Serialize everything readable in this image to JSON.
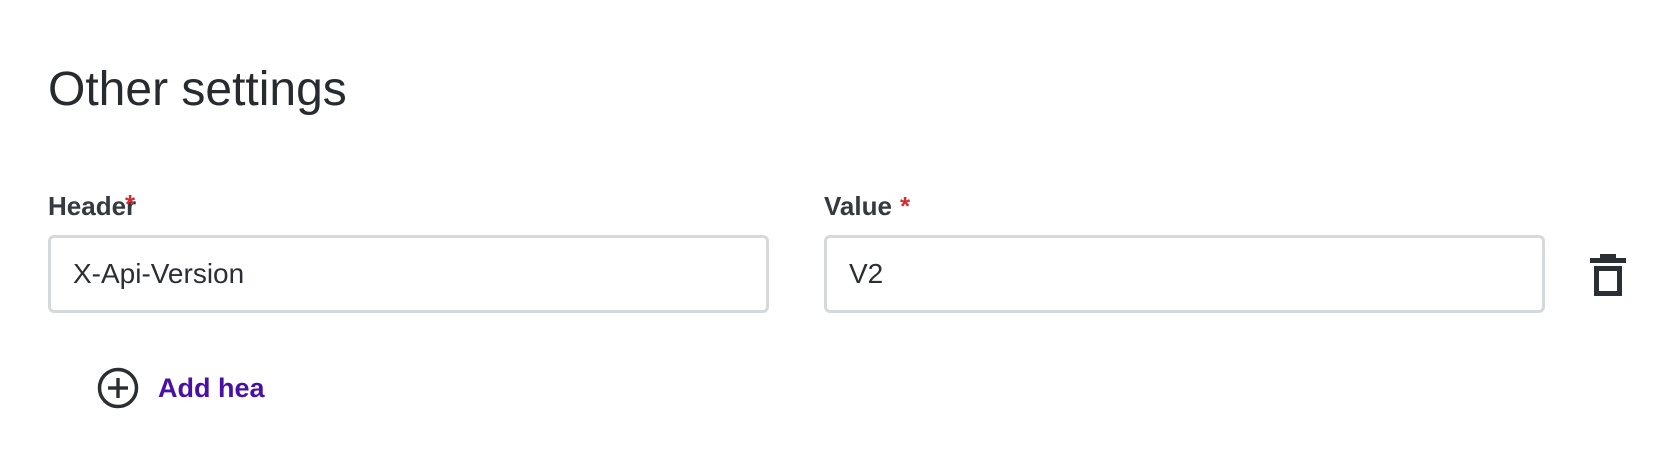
{
  "section": {
    "title": "Other settings"
  },
  "fields": {
    "header": {
      "label": "Header",
      "required_mark": "*",
      "value": "X-Api-Version"
    },
    "value": {
      "label": "Value",
      "required_mark": "*",
      "value": "V2"
    }
  },
  "actions": {
    "add_header_label": "Add hea",
    "delete_icon": "trash-icon",
    "add_icon": "plus-circle-icon"
  },
  "colors": {
    "required": "#d32f2f",
    "link": "#4a0fa3",
    "input_border": "#d5d9dc",
    "text": "#272b30"
  }
}
